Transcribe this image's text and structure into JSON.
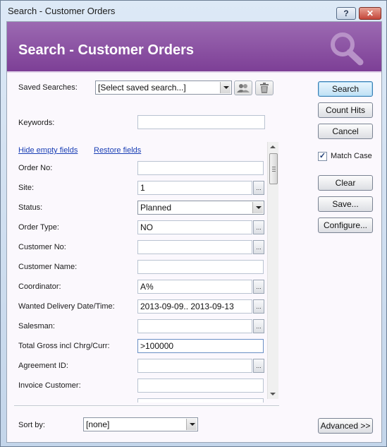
{
  "window": {
    "title": "Search - Customer Orders",
    "help_label": "?",
    "close_label": "✕"
  },
  "banner": {
    "title": "Search - Customer Orders",
    "icon": "magnifier-icon"
  },
  "saved_searches": {
    "label": "Saved Searches:",
    "value": "[Select saved search...]"
  },
  "keywords": {
    "label": "Keywords:",
    "value": ""
  },
  "links": {
    "hide_empty": "Hide empty fields",
    "restore": "Restore fields"
  },
  "fields": [
    {
      "label": "Order No:",
      "value": "",
      "type": "text"
    },
    {
      "label": "Site:",
      "value": "1",
      "type": "lov"
    },
    {
      "label": "Status:",
      "value": "Planned",
      "type": "select"
    },
    {
      "label": "Order Type:",
      "value": "NO",
      "type": "lov"
    },
    {
      "label": "Customer No:",
      "value": "",
      "type": "lov"
    },
    {
      "label": "Customer Name:",
      "value": "",
      "type": "text"
    },
    {
      "label": "Coordinator:",
      "value": "A%",
      "type": "lov"
    },
    {
      "label": "Wanted Delivery Date/Time:",
      "value": "2013-09-09.. 2013-09-13",
      "type": "lov"
    },
    {
      "label": "Salesman:",
      "value": "",
      "type": "lov"
    },
    {
      "label": "Total Gross incl Chrg/Curr:",
      "value": ">100000",
      "type": "text"
    },
    {
      "label": "Agreement ID:",
      "value": "",
      "type": "lov"
    },
    {
      "label": "Invoice Customer:",
      "value": "",
      "type": "text"
    }
  ],
  "lov_button": "...",
  "buttons": {
    "search": "Search",
    "count_hits": "Count Hits",
    "cancel": "Cancel",
    "clear": "Clear",
    "save": "Save...",
    "configure": "Configure...",
    "advanced": "Advanced >>"
  },
  "match_case": {
    "label": "Match Case",
    "checked": true,
    "mark": "✓"
  },
  "sort_by": {
    "label": "Sort by:",
    "value": "[none]"
  },
  "colors": {
    "banner": "#8a50a3",
    "accent": "#3c7fb1"
  }
}
